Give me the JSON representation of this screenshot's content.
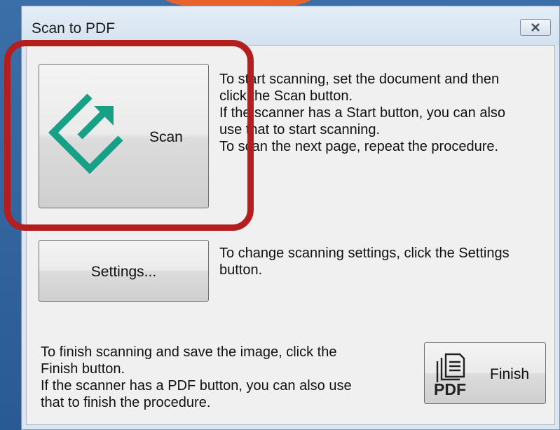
{
  "window": {
    "title": "Scan to PDF",
    "close_icon": "close-x-icon"
  },
  "scan": {
    "button_label": "Scan",
    "icon": "scan-arrow-icon",
    "description": "To start scanning, set the document and then\nclick the Scan button.\nIf the scanner has a Start button, you can also\nuse that to start scanning.\nTo scan the next page, repeat the procedure."
  },
  "settings": {
    "button_label": "Settings...",
    "description": "To change scanning settings, click the Settings\nbutton."
  },
  "finish": {
    "button_label": "Finish",
    "icon": "pdf-document-icon",
    "icon_text": "PDF",
    "description": "To finish scanning and save the image, click the\nFinish button.\nIf the scanner has a PDF button, you can also use\nthat to finish the procedure."
  },
  "colors": {
    "scan_icon": "#16a085",
    "highlight": "#b41e1e"
  }
}
